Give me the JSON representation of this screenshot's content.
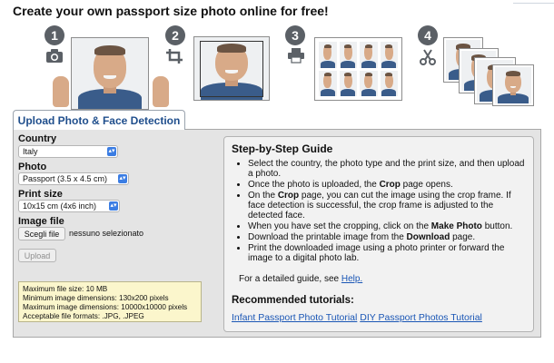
{
  "hero": {
    "title": "Create your own passport size photo online for free!",
    "steps": [
      {
        "number": "1",
        "icon": "camera-icon"
      },
      {
        "number": "2",
        "icon": "crop-icon"
      },
      {
        "number": "3",
        "icon": "printer-icon"
      },
      {
        "number": "4",
        "icon": "scissors-icon"
      }
    ]
  },
  "tab": {
    "label": "Upload Photo & Face Detection"
  },
  "form": {
    "country_label": "Country",
    "country_value": "Italy",
    "photo_label": "Photo",
    "photo_value": "Passport (3.5 x 4.5 cm)",
    "print_label": "Print size",
    "print_value": "10x15 cm (4x6 inch)",
    "file_label": "Image file",
    "choose_button": "Scegli file",
    "no_file_text": "nessuno selezionato",
    "upload_button": "Upload"
  },
  "info": {
    "lines": [
      "Maximum file size: 10 MB",
      "Minimum image dimensions: 130x200 pixels",
      "Maximum image dimensions: 10000x10000 pixels",
      "Acceptable file formats: .JPG, .JPEG"
    ]
  },
  "guide": {
    "title": "Step-by-Step Guide",
    "steps": [
      {
        "pre": "Select the country, the photo type and the print size, and then upload a photo.",
        "bold": "",
        "post": ""
      },
      {
        "pre": "Once the photo is uploaded, the ",
        "bold": "Crop",
        "post": " page opens."
      },
      {
        "pre": "On the ",
        "bold": "Crop",
        "post": " page, you can cut the image using the crop frame. If face detection is successful, the crop frame is adjusted to the detected face."
      },
      {
        "pre": "When you have set the cropping, click on the ",
        "bold": "Make Photo",
        "post": " button."
      },
      {
        "pre": "Download the printable image from the ",
        "bold": "Download",
        "post": " page."
      },
      {
        "pre": "Print the downloaded image using a photo printer or forward the image to a digital photo lab.",
        "bold": "",
        "post": ""
      }
    ],
    "detail_text": "For a detailed guide, see ",
    "detail_link": "Help.",
    "recommended_title": "Recommended tutorials:",
    "tutorial_links": [
      "Infant Passport Photo Tutorial",
      "DIY Passport Photos Tutorial"
    ]
  },
  "colors": {
    "accent": "#1f4e8c",
    "link": "#1a56b5",
    "select_arrow": "#3b7de3",
    "info_bg": "#fbf6cc"
  }
}
